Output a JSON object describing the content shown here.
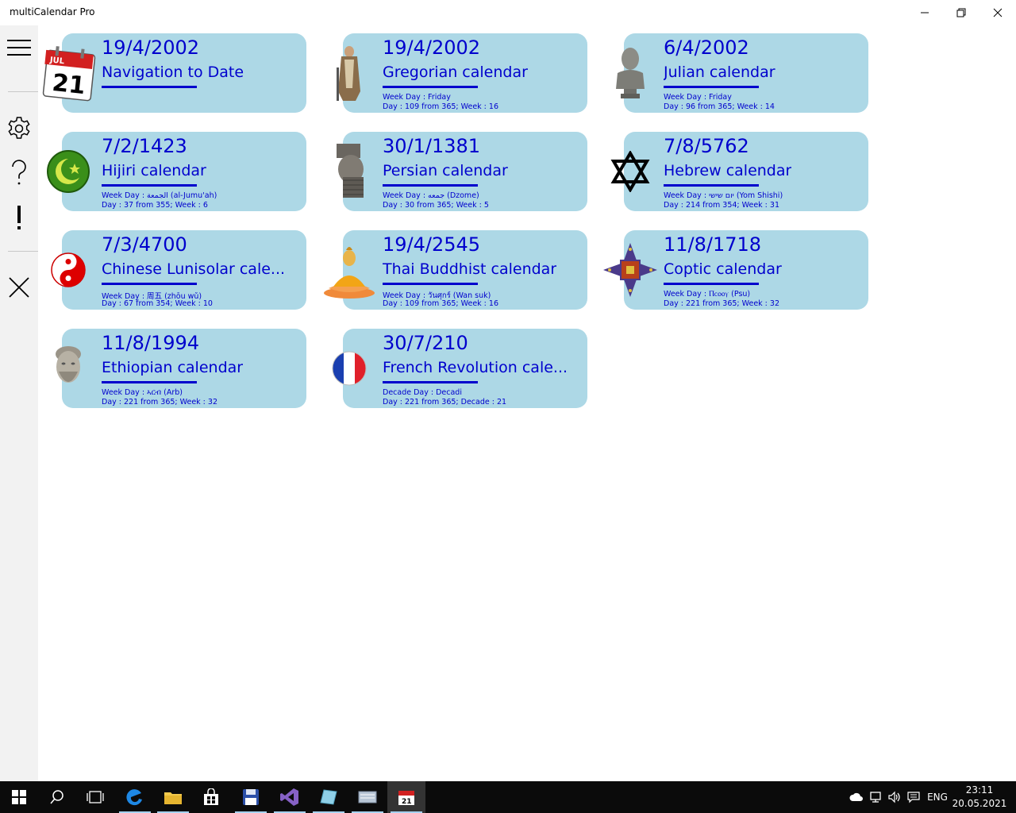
{
  "window": {
    "title": "multiCalendar Pro"
  },
  "tiles": [
    {
      "date": "19/4/2002",
      "name": "Navigation to Date",
      "info1": "",
      "info2": "",
      "icon": "calendar-page-icon"
    },
    {
      "date": "19/4/2002",
      "name": "Gregorian calendar",
      "info1": "Week Day : Friday",
      "info2": "Day : 109 from 365; Week : 16",
      "icon": "pope-gregory-icon"
    },
    {
      "date": "6/4/2002",
      "name": "Julian calendar",
      "info1": "Week Day : Friday",
      "info2": "Day : 96 from 365; Week : 14",
      "icon": "caesar-bust-icon"
    },
    {
      "date": "7/2/1423",
      "name": "Hijiri calendar",
      "info1": "Week Day : الجمعة (al-Jumu'ah)",
      "info2": "Day : 37 from 355; Week : 6",
      "icon": "crescent-star-icon"
    },
    {
      "date": "30/1/1381",
      "name": "Persian calendar",
      "info1": "Week Day : جمعه (Dzome)",
      "info2": "Day : 30 from 365; Week : 5",
      "icon": "persian-relief-icon"
    },
    {
      "date": "7/8/5762",
      "name": "Hebrew calendar",
      "info1": "Week Day : יום שישי (Yom Shishi)",
      "info2": "Day : 214 from 354; Week : 31",
      "icon": "star-of-david-icon"
    },
    {
      "date": "7/3/4700",
      "name": "Chinese Lunisolar cale...",
      "info1": "Week Day : 周五 (zhōu wǔ)",
      "info2": "Day : 67 from 354; Week : 10",
      "icon": "yin-yang-icon"
    },
    {
      "date": "19/4/2545",
      "name": "Thai Buddhist calendar",
      "info1": "Week Day : วันศุกร์ (Wan suk)",
      "info2": "Day : 109 from 365; Week : 16",
      "icon": "buddha-icon"
    },
    {
      "date": "11/8/1718",
      "name": "Coptic calendar",
      "info1": "Week Day : Ⲡⲥⲟⲟⲩ (Psu)",
      "info2": "Day : 221 from 365; Week : 32",
      "icon": "coptic-cross-icon"
    },
    {
      "date": "11/8/1994",
      "name": "Ethiopian calendar",
      "info1": "Week Day : ኣርብ (Arb)",
      "info2": "Day : 221 from 365; Week : 32",
      "icon": "ethiopian-bust-icon"
    },
    {
      "date": "30/7/210",
      "name": "French Revolution cale...",
      "info1": "Decade Day : Decadi",
      "info2": "Day : 221 from 365; Decade : 21",
      "icon": "french-flag-icon"
    }
  ],
  "icon_text": {
    "calendar_month": "JUL",
    "calendar_day": "21"
  },
  "taskbar": {
    "language": "ENG",
    "time": "23:11",
    "date": "20.05.2021"
  },
  "colors": {
    "tile_bg": "#add8e6",
    "tile_text": "#0000cd",
    "pane_bg": "#f2f2f2"
  }
}
